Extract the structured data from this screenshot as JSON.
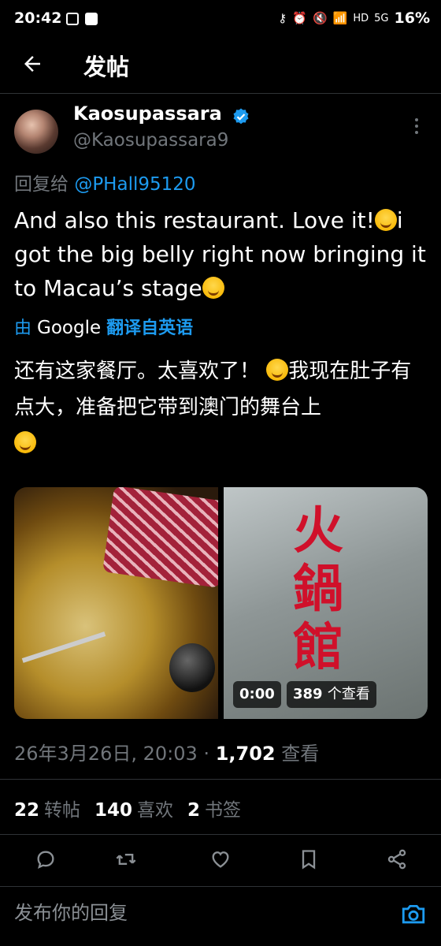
{
  "status_bar": {
    "time": "20:42",
    "battery": "16%",
    "network": "5G",
    "hd": "HD"
  },
  "header": {
    "title": "发帖"
  },
  "tweet": {
    "author_name": "Kaosupassara",
    "author_handle": "@Kaosupassara9",
    "reply_prefix": "回复给",
    "reply_to": "@PHall95120",
    "text_part1": "And also this restaurant. Love it!",
    "text_part2": "i got the big belly right now bringing it to Macau’s stage",
    "translate_by": "由",
    "translate_google": "Google",
    "translate_label": "翻译自英语",
    "translated_part1": "还有这家餐厅。太喜欢了！",
    "translated_part2": "我现在肚子有点大，准备把它带到澳门的舞台上",
    "video_time": "0:00",
    "video_views_count": "389",
    "video_views_label": "个查看",
    "timestamp": "26年3月26日, 20:03",
    "separator": "·",
    "views_count": "1,702",
    "views_label": "查看"
  },
  "stats": {
    "reposts": "22",
    "reposts_label": "转帖",
    "likes": "140",
    "likes_label": "喜欢",
    "bookmarks": "2",
    "bookmarks_label": "书签"
  },
  "reply_bar": {
    "placeholder": "发布你的回复"
  },
  "colors": {
    "accent": "#1d9bf0",
    "background": "#000000",
    "sign_red": "#d0102a"
  },
  "icons": [
    "back-arrow-icon",
    "verified-badge-icon",
    "more-icon",
    "reply-icon",
    "repost-icon",
    "like-icon",
    "bookmark-icon",
    "share-icon",
    "camera-icon"
  ]
}
